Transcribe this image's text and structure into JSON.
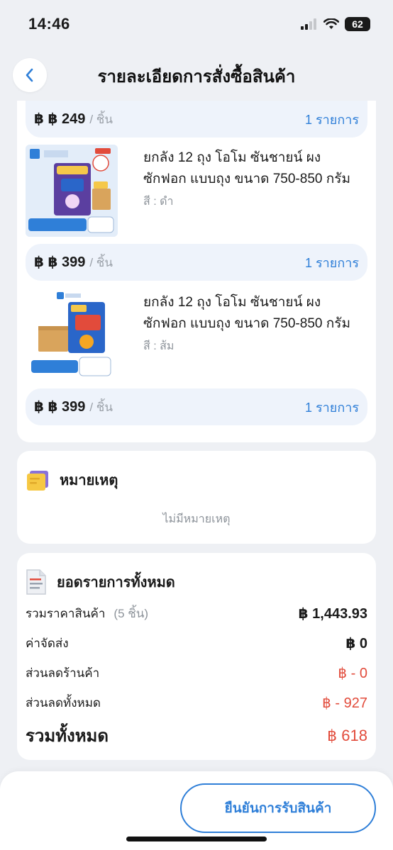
{
  "status": {
    "time": "14:46",
    "battery": "62"
  },
  "header": {
    "title": "รายละเอียดการสั่งซื้อสินค้า"
  },
  "items": [
    {
      "price": "฿ ฿ 249",
      "unit": "/ ชิ้น",
      "qty": "1 รายการ"
    },
    {
      "name": "ยกลัง 12 ถุง โอโม ซันชายน์ ผงซักฟอก แบบถุง ขนาด 750-850 กรัม",
      "variant": "สี : ดำ",
      "price": "฿ ฿ 399",
      "unit": "/ ชิ้น",
      "qty": "1 รายการ",
      "thumb": {
        "store": "OFFICIAL STORE",
        "promo": "ซักผ้า 40 นาที",
        "brand": "โอโม ซันชายน์",
        "size": "750 มล",
        "pack": "ยกลัง",
        "count": "X12"
      }
    },
    {
      "name": "ยกลัง 12 ถุง โอโม ซันชายน์ ผงซักฟอก แบบถุง ขนาด 750-850 กรัม",
      "variant": "สี : ส้ม",
      "price": "฿ ฿ 399",
      "unit": "/ ชิ้น",
      "qty": "1 รายการ",
      "thumb": {
        "store": "OFFICIAL STORE",
        "brand": "โอโม ซันชายน์",
        "size": "850 กรัม",
        "count": "12 ถุง"
      }
    }
  ],
  "note": {
    "title": "หมายเหตุ",
    "empty": "ไม่มีหมายเหตุ"
  },
  "summary": {
    "title": "ยอดรายการทั้งหมด",
    "subtotal_label": "รวมราคาสินค้า",
    "subtotal_count": "(5 ชิ้น)",
    "subtotal_value": "฿ 1,443.93",
    "shipping_label": "ค่าจัดส่ง",
    "shipping_value": "฿ 0",
    "shop_discount_label": "ส่วนลดร้านค้า",
    "shop_discount_value": "฿ - 0",
    "total_discount_label": "ส่วนลดทั้งหมด",
    "total_discount_value": "฿ - 927",
    "grand_label": "รวมทั้งหมด",
    "grand_value": "฿ 618"
  },
  "footer": {
    "confirm_label": "ยืนยันการรับสินค้า"
  },
  "colors": {
    "accent": "#2f7fd8",
    "discount": "#e24b3b",
    "price_bar": "#eef3fb"
  }
}
